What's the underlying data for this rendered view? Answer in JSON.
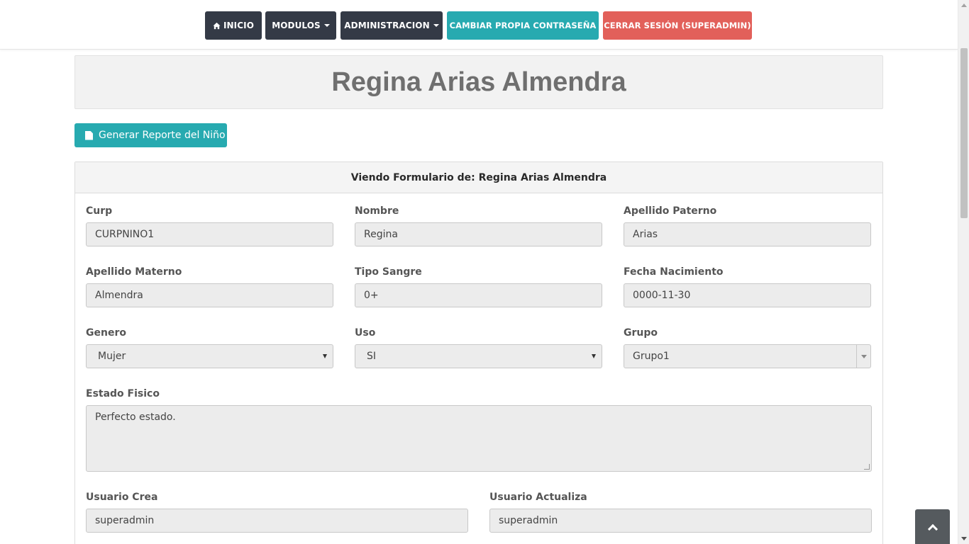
{
  "navbar": {
    "inicio": "INICIO",
    "modulos": "MODULOS",
    "administracion": "ADMINISTRACION",
    "cambiar": "CAMBIAR PROPIA CONTRASEÑA",
    "cerrar": "CERRAR SESIÓN (SUPERADMIN)"
  },
  "page_title": "Regina Arias Almendra",
  "report_button": "Generar Reporte del Niño",
  "card": {
    "header": "Viendo Formulario de: Regina Arias Almendra"
  },
  "form": {
    "curp": {
      "label": "Curp",
      "value": "CURPNINO1"
    },
    "nombre": {
      "label": "Nombre",
      "value": "Regina"
    },
    "apellido_paterno": {
      "label": "Apellido Paterno",
      "value": "Arias"
    },
    "apellido_materno": {
      "label": "Apellido Materno",
      "value": "Almendra"
    },
    "tipo_sangre": {
      "label": "Tipo Sangre",
      "value": "0+"
    },
    "fecha_nacimiento": {
      "label": "Fecha Nacimiento",
      "value": "0000-11-30"
    },
    "genero": {
      "label": "Genero",
      "value": "Mujer"
    },
    "uso": {
      "label": "Uso",
      "value": "SI"
    },
    "grupo": {
      "label": "Grupo",
      "value": "Grupo1"
    },
    "estado_fisico": {
      "label": "Estado Fisico",
      "value": "Perfecto estado."
    },
    "usuario_crea": {
      "label": "Usuario Crea",
      "value": "superadmin"
    },
    "usuario_actualiza": {
      "label": "Usuario Actualiza",
      "value": "superadmin"
    }
  },
  "colors": {
    "nav_dark": "#343a46",
    "teal": "#27aab0",
    "red": "#e2605a",
    "input_bg": "#ececec"
  }
}
